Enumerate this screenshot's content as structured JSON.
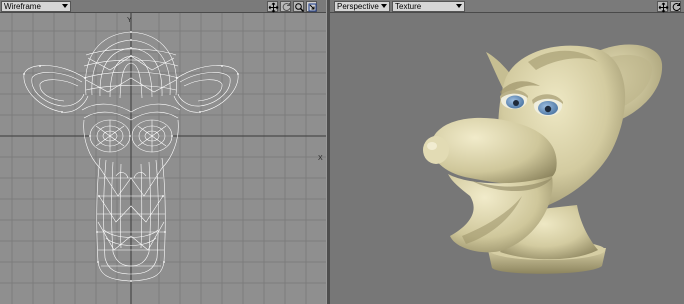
{
  "left_viewport": {
    "view_mode": "Wireframe",
    "colors": {
      "background": "#8f8f8f",
      "grid": "#7c7c7c",
      "axis": "#3a3a3a",
      "wire": "#ffffff"
    }
  },
  "right_viewport": {
    "view_mode": "Perspective",
    "render_mode": "Texture",
    "colors": {
      "background": "#777777",
      "model": "#d9d2aa",
      "model_shadow": "#8e8660",
      "eye_iris": "#6c98c8"
    }
  },
  "toolbar_icons": [
    "move-icon",
    "rotate-icon",
    "zoom-icon",
    "maximize-icon"
  ]
}
